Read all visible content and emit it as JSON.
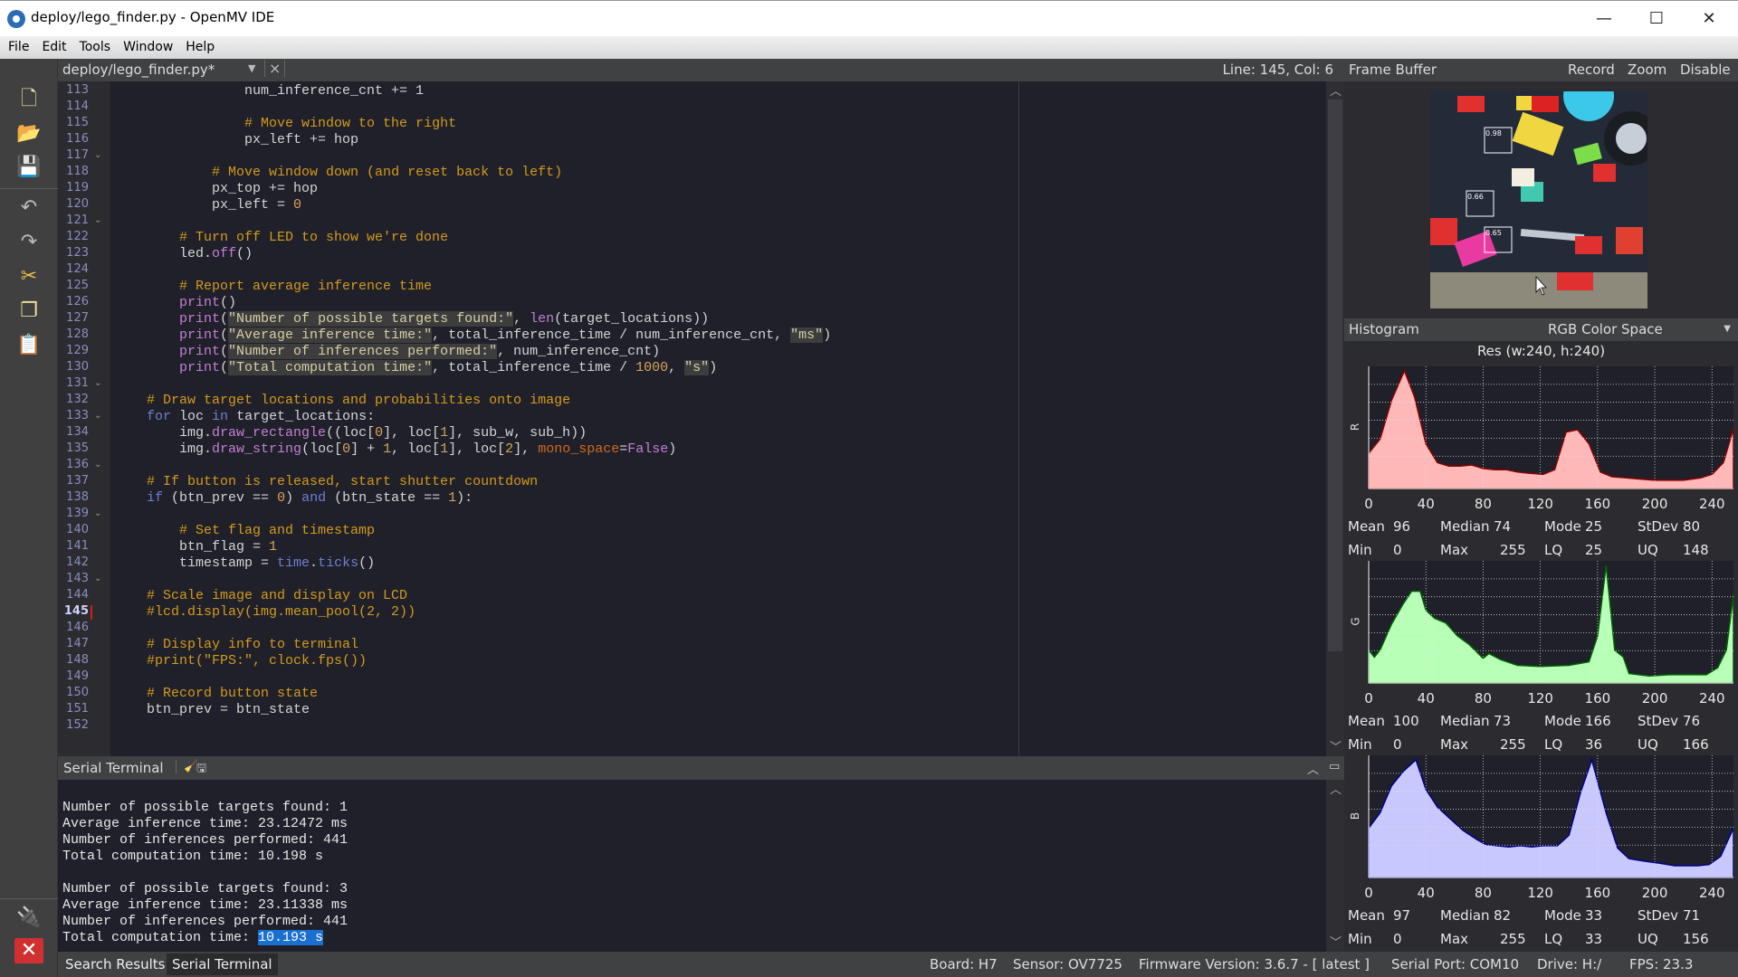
{
  "window": {
    "title": "deploy/lego_finder.py - OpenMV IDE",
    "minimize": "—",
    "maximize": "☐",
    "close": "✕"
  },
  "menu": [
    "File",
    "Edit",
    "Tools",
    "Window",
    "Help"
  ],
  "toolbar": {
    "icons": [
      "new-file-icon",
      "open-folder-icon",
      "save-icon",
      "undo-icon",
      "redo-icon",
      "cut-icon",
      "copy-icon",
      "paste-icon"
    ],
    "bottom": [
      "connect-icon",
      "stop-icon"
    ]
  },
  "editor": {
    "file_tab": "deploy/lego_finder.py*",
    "cursor_position": "Line: 145, Col: 6",
    "current_line": 145,
    "first_line": 113,
    "fold_lines": [
      117,
      121,
      131,
      133,
      136,
      139,
      143
    ],
    "lines": [
      [
        {
          "t": "                num_inference_cnt += 1"
        }
      ],
      [],
      [
        {
          "t": "                "
        },
        {
          "t": "# Move window to the right",
          "c": "cm"
        }
      ],
      [
        {
          "t": "                px_left += hop"
        }
      ],
      [],
      [
        {
          "t": "            "
        },
        {
          "t": "# Move window down (and reset back to left)",
          "c": "cm"
        }
      ],
      [
        {
          "t": "            px_top += hop"
        }
      ],
      [
        {
          "t": "            px_left = "
        },
        {
          "t": "0",
          "c": "num"
        }
      ],
      [],
      [
        {
          "t": "        "
        },
        {
          "t": "# Turn off LED to show we're done",
          "c": "cm"
        }
      ],
      [
        {
          "t": "        led."
        },
        {
          "t": "off",
          "c": "fn"
        },
        {
          "t": "()"
        }
      ],
      [],
      [
        {
          "t": "        "
        },
        {
          "t": "# Report average inference time",
          "c": "cm"
        }
      ],
      [
        {
          "t": "        "
        },
        {
          "t": "print",
          "c": "fn"
        },
        {
          "t": "()"
        }
      ],
      [
        {
          "t": "        "
        },
        {
          "t": "print",
          "c": "fn"
        },
        {
          "t": "("
        },
        {
          "t": "\"Number of possible targets found:\"",
          "c": "str"
        },
        {
          "t": ", "
        },
        {
          "t": "len",
          "c": "fn"
        },
        {
          "t": "(target_locations))"
        }
      ],
      [
        {
          "t": "        "
        },
        {
          "t": "print",
          "c": "fn"
        },
        {
          "t": "("
        },
        {
          "t": "\"Average inference time:\"",
          "c": "str"
        },
        {
          "t": ", total_inference_time / num_inference_cnt, "
        },
        {
          "t": "\"ms\"",
          "c": "str"
        },
        {
          "t": ")"
        }
      ],
      [
        {
          "t": "        "
        },
        {
          "t": "print",
          "c": "fn"
        },
        {
          "t": "("
        },
        {
          "t": "\"Number of inferences performed:\"",
          "c": "str"
        },
        {
          "t": ", num_inference_cnt)"
        }
      ],
      [
        {
          "t": "        "
        },
        {
          "t": "print",
          "c": "fn"
        },
        {
          "t": "("
        },
        {
          "t": "\"Total computation time:\"",
          "c": "str"
        },
        {
          "t": ", total_inference_time / "
        },
        {
          "t": "1000",
          "c": "num"
        },
        {
          "t": ", "
        },
        {
          "t": "\"s\"",
          "c": "str"
        },
        {
          "t": ")"
        }
      ],
      [],
      [
        {
          "t": "    "
        },
        {
          "t": "# Draw target locations and probabilities onto image",
          "c": "cm"
        }
      ],
      [
        {
          "t": "    "
        },
        {
          "t": "for",
          "c": "kw"
        },
        {
          "t": " loc "
        },
        {
          "t": "in",
          "c": "kw"
        },
        {
          "t": " target_locations:"
        }
      ],
      [
        {
          "t": "        img."
        },
        {
          "t": "draw_rectangle",
          "c": "fn"
        },
        {
          "t": "((loc["
        },
        {
          "t": "0",
          "c": "num"
        },
        {
          "t": "], loc["
        },
        {
          "t": "1",
          "c": "num"
        },
        {
          "t": "], sub_w, sub_h))"
        }
      ],
      [
        {
          "t": "        img."
        },
        {
          "t": "draw_string",
          "c": "fn"
        },
        {
          "t": "(loc["
        },
        {
          "t": "0",
          "c": "num"
        },
        {
          "t": "] + "
        },
        {
          "t": "1",
          "c": "num"
        },
        {
          "t": ", loc["
        },
        {
          "t": "1",
          "c": "num"
        },
        {
          "t": "], loc["
        },
        {
          "t": "2",
          "c": "num"
        },
        {
          "t": "], "
        },
        {
          "t": "mono_space",
          "c": "prm"
        },
        {
          "t": "="
        },
        {
          "t": "False",
          "c": "bool"
        },
        {
          "t": ")"
        }
      ],
      [],
      [
        {
          "t": "    "
        },
        {
          "t": "# If button is released, start shutter countdown",
          "c": "cm"
        }
      ],
      [
        {
          "t": "    "
        },
        {
          "t": "if",
          "c": "kw"
        },
        {
          "t": " (btn_prev == "
        },
        {
          "t": "0",
          "c": "num"
        },
        {
          "t": ") "
        },
        {
          "t": "and",
          "c": "kw"
        },
        {
          "t": " (btn_state == "
        },
        {
          "t": "1",
          "c": "num"
        },
        {
          "t": "):"
        }
      ],
      [],
      [
        {
          "t": "        "
        },
        {
          "t": "# Set flag and timestamp",
          "c": "cm"
        }
      ],
      [
        {
          "t": "        btn_flag = "
        },
        {
          "t": "1",
          "c": "num"
        }
      ],
      [
        {
          "t": "        timestamp = "
        },
        {
          "t": "time",
          "c": "kw"
        },
        {
          "t": "."
        },
        {
          "t": "ticks",
          "c": "kw"
        },
        {
          "t": "()"
        }
      ],
      [],
      [
        {
          "t": "    "
        },
        {
          "t": "# Scale image and display on LCD",
          "c": "cm"
        }
      ],
      [
        {
          "t": "    "
        },
        {
          "t": "#lcd.display(img.mean_pool(2, 2))",
          "c": "cm"
        }
      ],
      [],
      [
        {
          "t": "    "
        },
        {
          "t": "# Display info to terminal",
          "c": "cm"
        }
      ],
      [
        {
          "t": "    "
        },
        {
          "t": "#print(\"FPS:\", clock.fps())",
          "c": "cm"
        }
      ],
      [],
      [
        {
          "t": "    "
        },
        {
          "t": "# Record button state",
          "c": "cm"
        }
      ],
      [
        {
          "t": "    btn_prev = btn_state"
        }
      ],
      []
    ]
  },
  "terminal": {
    "title": "Serial Terminal",
    "lines": [
      "",
      "Number of possible targets found: 1",
      "Average inference time: 23.12472 ms",
      "Number of inferences performed: 441",
      "Total computation time: 10.198 s",
      "",
      "Number of possible targets found: 3",
      "Average inference time: 23.11338 ms",
      "Number of inferences performed: 441",
      "Total computation time: "
    ],
    "selected_text": "10.193 s"
  },
  "bottom_tabs": [
    {
      "label": "Search Results",
      "active": false
    },
    {
      "label": "Serial Terminal",
      "active": true
    }
  ],
  "status": {
    "board": "Board: H7",
    "sensor": "Sensor: OV7725",
    "firmware": "Firmware Version: 3.6.7 - [ latest ]",
    "serial_port": "Serial Port: COM10",
    "drive": "Drive: H:/",
    "fps": "FPS: 23.3"
  },
  "frame_buffer": {
    "title": "Frame Buffer",
    "actions": [
      "Record",
      "Zoom",
      "Disable"
    ],
    "detections": [
      {
        "label": "0.98"
      },
      {
        "label": "0.66"
      },
      {
        "label": "0.65"
      }
    ]
  },
  "histogram": {
    "title": "Histogram",
    "color_space": "RGB Color Space",
    "resolution": "Res (w:240, h:240)",
    "x_ticks": [
      "0",
      "40",
      "80",
      "120",
      "160",
      "200",
      "240"
    ],
    "channels": [
      {
        "name": "R",
        "fill": "#ffb8b8",
        "stroke": "#8b0000",
        "stats": {
          "Mean": "96",
          "Median": "74",
          "Mode": "25",
          "StDev": "80",
          "Min": "0",
          "Max": "255",
          "LQ": "25",
          "UQ": "148"
        },
        "profile": [
          [
            0,
            0.3
          ],
          [
            8,
            0.42
          ],
          [
            16,
            0.75
          ],
          [
            25,
            1.0
          ],
          [
            32,
            0.78
          ],
          [
            40,
            0.38
          ],
          [
            48,
            0.22
          ],
          [
            56,
            0.19
          ],
          [
            64,
            0.19
          ],
          [
            72,
            0.2
          ],
          [
            80,
            0.17
          ],
          [
            88,
            0.16
          ],
          [
            96,
            0.16
          ],
          [
            104,
            0.14
          ],
          [
            112,
            0.13
          ],
          [
            122,
            0.12
          ],
          [
            130,
            0.16
          ],
          [
            138,
            0.48
          ],
          [
            146,
            0.5
          ],
          [
            154,
            0.38
          ],
          [
            162,
            0.14
          ],
          [
            170,
            0.1
          ],
          [
            180,
            0.09
          ],
          [
            190,
            0.08
          ],
          [
            200,
            0.07
          ],
          [
            210,
            0.07
          ],
          [
            220,
            0.07
          ],
          [
            232,
            0.09
          ],
          [
            240,
            0.12
          ],
          [
            248,
            0.22
          ],
          [
            255,
            0.51
          ]
        ]
      },
      {
        "name": "G",
        "fill": "#b8ffb8",
        "stroke": "#006400",
        "stats": {
          "Mean": "100",
          "Median": "73",
          "Mode": "166",
          "StDev": "76",
          "Min": "0",
          "Max": "255",
          "LQ": "36",
          "UQ": "166"
        },
        "profile": [
          [
            0,
            0.28
          ],
          [
            4,
            0.22
          ],
          [
            8,
            0.28
          ],
          [
            16,
            0.5
          ],
          [
            24,
            0.67
          ],
          [
            30,
            0.78
          ],
          [
            36,
            0.78
          ],
          [
            40,
            0.62
          ],
          [
            46,
            0.55
          ],
          [
            54,
            0.51
          ],
          [
            62,
            0.4
          ],
          [
            70,
            0.33
          ],
          [
            80,
            0.21
          ],
          [
            84,
            0.25
          ],
          [
            92,
            0.2
          ],
          [
            104,
            0.15
          ],
          [
            120,
            0.14
          ],
          [
            140,
            0.15
          ],
          [
            154,
            0.18
          ],
          [
            160,
            0.4
          ],
          [
            166,
            1.0
          ],
          [
            172,
            0.28
          ],
          [
            178,
            0.22
          ],
          [
            182,
            0.08
          ],
          [
            196,
            0.06
          ],
          [
            210,
            0.07
          ],
          [
            236,
            0.07
          ],
          [
            244,
            0.13
          ],
          [
            250,
            0.28
          ],
          [
            255,
            0.75
          ]
        ]
      },
      {
        "name": "B",
        "fill": "#c8c8ff",
        "stroke": "#00008b",
        "stats": {
          "Mean": "97",
          "Median": "82",
          "Mode": "33",
          "StDev": "71",
          "Min": "0",
          "Max": "255",
          "LQ": "33",
          "UQ": "156"
        },
        "profile": [
          [
            0,
            0.42
          ],
          [
            8,
            0.55
          ],
          [
            16,
            0.78
          ],
          [
            24,
            0.9
          ],
          [
            33,
            1.0
          ],
          [
            40,
            0.75
          ],
          [
            48,
            0.6
          ],
          [
            56,
            0.51
          ],
          [
            66,
            0.4
          ],
          [
            76,
            0.32
          ],
          [
            82,
            0.28
          ],
          [
            98,
            0.26
          ],
          [
            106,
            0.27
          ],
          [
            114,
            0.26
          ],
          [
            122,
            0.27
          ],
          [
            132,
            0.27
          ],
          [
            140,
            0.36
          ],
          [
            148,
            0.72
          ],
          [
            156,
            1.0
          ],
          [
            166,
            0.55
          ],
          [
            174,
            0.25
          ],
          [
            182,
            0.16
          ],
          [
            192,
            0.14
          ],
          [
            204,
            0.12
          ],
          [
            214,
            0.1
          ],
          [
            230,
            0.1
          ],
          [
            238,
            0.11
          ],
          [
            246,
            0.18
          ],
          [
            255,
            0.42
          ]
        ]
      }
    ]
  }
}
